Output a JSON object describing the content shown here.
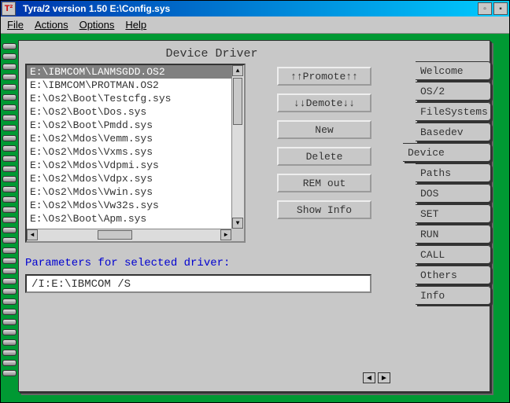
{
  "titlebar": {
    "sysicon_text": "T²",
    "title": "Tyra/2 version 1.50   E:\\Config.sys"
  },
  "menubar": [
    "File",
    "Actions",
    "Options",
    "Help"
  ],
  "page": {
    "title": "Device Driver",
    "param_label": "Parameters for selected driver:",
    "param_value": "/I:E:\\IBMCOM /S"
  },
  "listbox": {
    "selected_index": 0,
    "items": [
      "E:\\IBMCOM\\LANMSGDD.OS2",
      "E:\\IBMCOM\\PROTMAN.OS2",
      "E:\\Os2\\Boot\\Testcfg.sys",
      "E:\\Os2\\Boot\\Dos.sys",
      "E:\\Os2\\Boot\\Pmdd.sys",
      "E:\\Os2\\Mdos\\Vemm.sys",
      "E:\\Os2\\Mdos\\Vxms.sys",
      "E:\\Os2\\Mdos\\Vdpmi.sys",
      "E:\\Os2\\Mdos\\Vdpx.sys",
      "E:\\Os2\\Mdos\\Vwin.sys",
      "E:\\Os2\\Mdos\\Vw32s.sys",
      "E:\\Os2\\Boot\\Apm.sys"
    ]
  },
  "buttons": {
    "promote": "↑↑Promote↑↑",
    "demote": "↓↓Demote↓↓",
    "new": "New",
    "delete": "Delete",
    "remout": "REM out",
    "showinfo": "Show Info"
  },
  "tabs": {
    "active_index": 4,
    "items": [
      "Welcome",
      "OS/2",
      "FileSystems",
      "Basedev",
      "Device",
      "Paths",
      "DOS",
      "SET",
      "RUN",
      "CALL",
      "Others",
      "Info"
    ]
  },
  "nav": {
    "prev": "◄",
    "next": "►"
  }
}
